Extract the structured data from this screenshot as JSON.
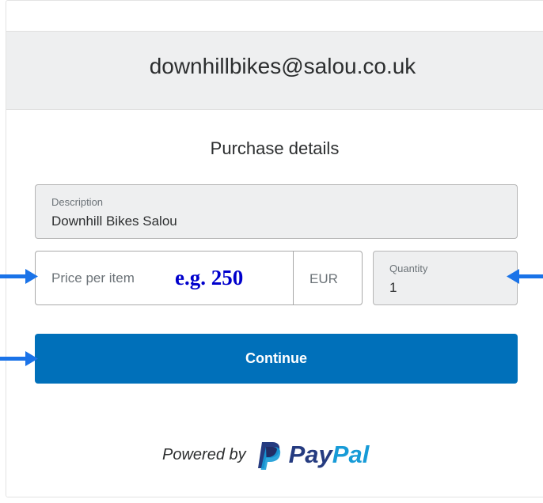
{
  "header": {
    "merchant_email": "downhillbikes@salou.co.uk"
  },
  "form": {
    "title": "Purchase details",
    "description": {
      "label": "Description",
      "value": "Downhill Bikes Salou"
    },
    "price": {
      "placeholder": "Price per item",
      "hint": "e.g. 250",
      "currency": "EUR"
    },
    "quantity": {
      "label": "Quantity",
      "value": "1"
    },
    "continue_label": "Continue"
  },
  "footer": {
    "powered_by": "Powered by",
    "brand_pay": "Pay",
    "brand_pal": "Pal"
  },
  "colors": {
    "button": "#0070ba",
    "annotation": "#0000cc",
    "arrow": "#1a73e8",
    "paypal_dark": "#253b80",
    "paypal_light": "#179bd7"
  },
  "icons": [
    "paypal-logo-icon",
    "arrow-right-icon",
    "arrow-left-icon"
  ]
}
